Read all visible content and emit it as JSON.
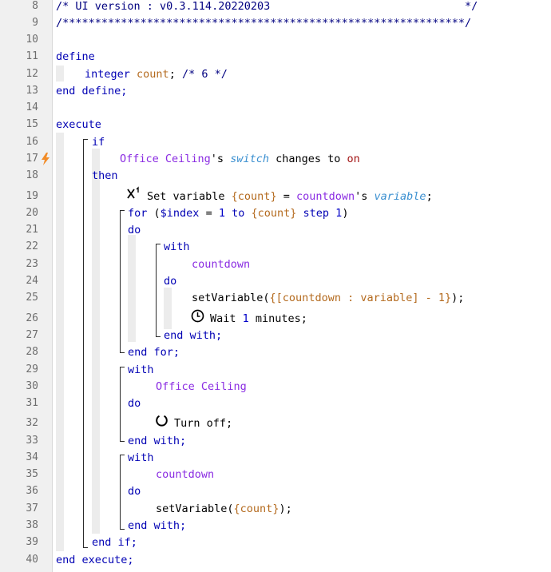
{
  "gutter": {
    "line_numbers": [
      "8",
      "9",
      "10",
      "11",
      "12",
      "13",
      "14",
      "15",
      "16",
      "17",
      "18",
      "19",
      "20",
      "21",
      "22",
      "23",
      "24",
      "25",
      "26",
      "27",
      "28",
      "29",
      "30",
      "31",
      "32",
      "33",
      "34",
      "35",
      "36",
      "37",
      "38",
      "39",
      "40"
    ],
    "trigger_line": "17"
  },
  "code": {
    "l8": {
      "text": "/* UI version : v0.3.114.20220203                              */"
    },
    "l9": {
      "text": "/**************************************************************/"
    },
    "l11": {
      "kw": "define"
    },
    "l12": {
      "type": "integer",
      "name": "count",
      "semi": ";",
      "comment": "/* 6 */"
    },
    "l13": {
      "kw": "end define;"
    },
    "l15": {
      "kw": "execute"
    },
    "l16": {
      "kw": "if"
    },
    "l17": {
      "device": "Office Ceiling",
      "poss": "'s",
      "attr": "switch",
      "changes": "changes to",
      "val": "on"
    },
    "l18": {
      "kw": "then"
    },
    "l19": {
      "text1": "Set variable ",
      "var": "{count}",
      "eq": " = ",
      "device": "countdown",
      "poss": "'s",
      "attr": "variable",
      "semi": ";"
    },
    "l20": {
      "kw": "for",
      "open": " (",
      "ivar": "$index",
      "eq": " = ",
      "n1": "1",
      "to": " to ",
      "var": "{count}",
      "step": " step ",
      "n2": "1",
      "close": ")"
    },
    "l21": {
      "kw": "do"
    },
    "l22": {
      "kw": "with"
    },
    "l23": {
      "device": "countdown"
    },
    "l24": {
      "kw": "do"
    },
    "l25": {
      "fn": "setVariable(",
      "expr": "{[countdown : variable] - 1}",
      "close": ");"
    },
    "l26": {
      "text1": "Wait ",
      "n": "1",
      "text2": " minutes;"
    },
    "l27": {
      "kw": "end with;"
    },
    "l28": {
      "kw": "end for;"
    },
    "l29": {
      "kw": "with"
    },
    "l30": {
      "device": "Office Ceiling"
    },
    "l31": {
      "kw": "do"
    },
    "l32": {
      "text1": "Turn off;"
    },
    "l33": {
      "kw": "end with;"
    },
    "l34": {
      "kw": "with"
    },
    "l35": {
      "device": "countdown"
    },
    "l36": {
      "kw": "do"
    },
    "l37": {
      "fn": "setVariable(",
      "var": "{count}",
      "close": ");"
    },
    "l38": {
      "kw": "end with;"
    },
    "l39": {
      "kw": "end if;"
    },
    "l40": {
      "kw": "end execute;"
    }
  },
  "colors": {
    "keyword": "#0000b4",
    "device": "#8a2be2",
    "attribute": "#3a8fd0",
    "variable": "#b46a1e",
    "trigger_bolt": "#f28c28"
  },
  "icons": {
    "l19": "superscript-x1-icon",
    "l26": "clock-icon",
    "l32": "power-icon",
    "l17": "lightning-bolt-icon"
  }
}
